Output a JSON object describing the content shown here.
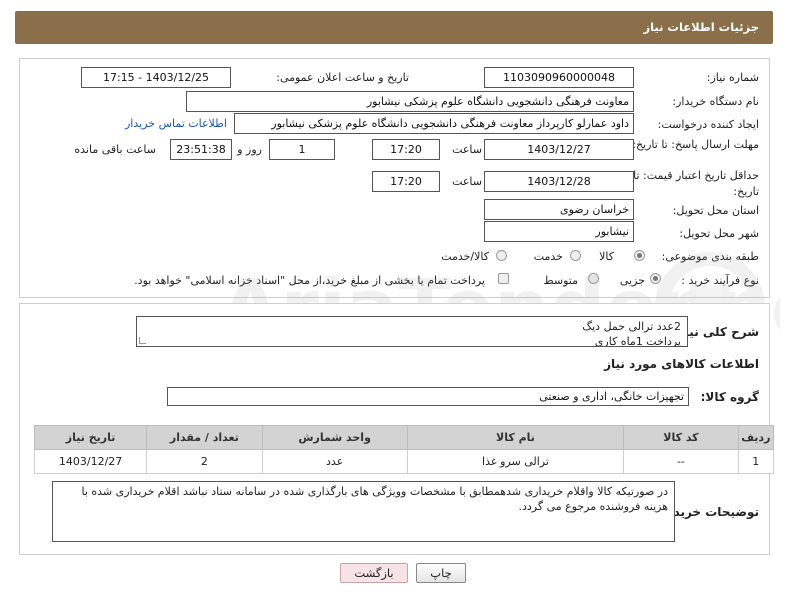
{
  "header": {
    "title": "جزئیات اطلاعات نیاز"
  },
  "need_number": {
    "label": "شماره نیاز:",
    "value": "1103090960000048"
  },
  "announce_datetime": {
    "label": "تاریخ و ساعت اعلان عمومی:",
    "value": "1403/12/25 - 17:15"
  },
  "buyer_org": {
    "label": "نام دستگاه خریدار:",
    "value": "معاونت فرهنگی دانشجویی دانشگاه علوم پزشکی نیشابور"
  },
  "requester": {
    "label": "ایجاد کننده درخواست:",
    "value": "داود عمارلو کارپرداز معاونت فرهنگی دانشجویی دانشگاه علوم پزشکی نیشابور",
    "contact_link": "اطلاعات تماس خریدار"
  },
  "deadline": {
    "label": "مهلت ارسال پاسخ: تا تاریخ:",
    "date": "1403/12/27",
    "time_label": "ساعت",
    "time": "17:20",
    "days": "1",
    "days_label": "روز و",
    "remaining": "23:51:38",
    "remaining_label": "ساعت باقی مانده"
  },
  "validity": {
    "label": "حداقل تاریخ اعتبار قیمت: تا تاریخ:",
    "date": "1403/12/28",
    "time_label": "ساعت",
    "time": "17:20"
  },
  "province": {
    "label": "استان محل تحویل:",
    "value": "خراسان رضوی"
  },
  "city": {
    "label": "شهر محل تحویل:",
    "value": "نیشابور"
  },
  "category": {
    "label": "طبقه بندی موضوعی:",
    "options": [
      "کالا",
      "خدمت",
      "کالا/خدمت"
    ],
    "selected": "کالا"
  },
  "purchase_type": {
    "label": "نوع فرآیند خرید :",
    "options": [
      "جزیی",
      "متوسط"
    ],
    "selected": "جزیی",
    "payment_note": "پرداخت تمام یا بخشی از مبلغ خرید،از محل \"اسناد خزانه اسلامی\" خواهد بود."
  },
  "description": {
    "label": "شرح کلی نیاز:",
    "line1": "2عدد ترالی حمل دیگ",
    "line2": "پرداخت 1ماه کاری"
  },
  "goods_info_title": "اطلاعات کالاهای مورد نیاز",
  "goods_group": {
    "label": "گروه کالا:",
    "value": "تجهیزات خانگی، اداری و صنعتی"
  },
  "table": {
    "headers": [
      "ردیف",
      "کد کالا",
      "نام کالا",
      "واحد شمارش",
      "تعداد / مقدار",
      "تاریخ نیاز"
    ],
    "rows": [
      [
        "1",
        "--",
        "ترالی سرو غذا",
        "عدد",
        "2",
        "1403/12/27"
      ]
    ]
  },
  "buyer_notes": {
    "label": "توضیحات خریدار:",
    "text": "در صورتیکه کالا واقلام خریداری شدهمطابق با مشخصات وویژگی های بارگذاری شده در سامانه ستاد نباشد اقلام خریداری شده با هزینه فروشنده مرجوع می گردد."
  },
  "buttons": {
    "print": "چاپ",
    "back": "بازگشت"
  },
  "colors": {
    "header": "#8a6f4a",
    "link": "#1a55b8",
    "table_header": "#d3d3d3"
  }
}
